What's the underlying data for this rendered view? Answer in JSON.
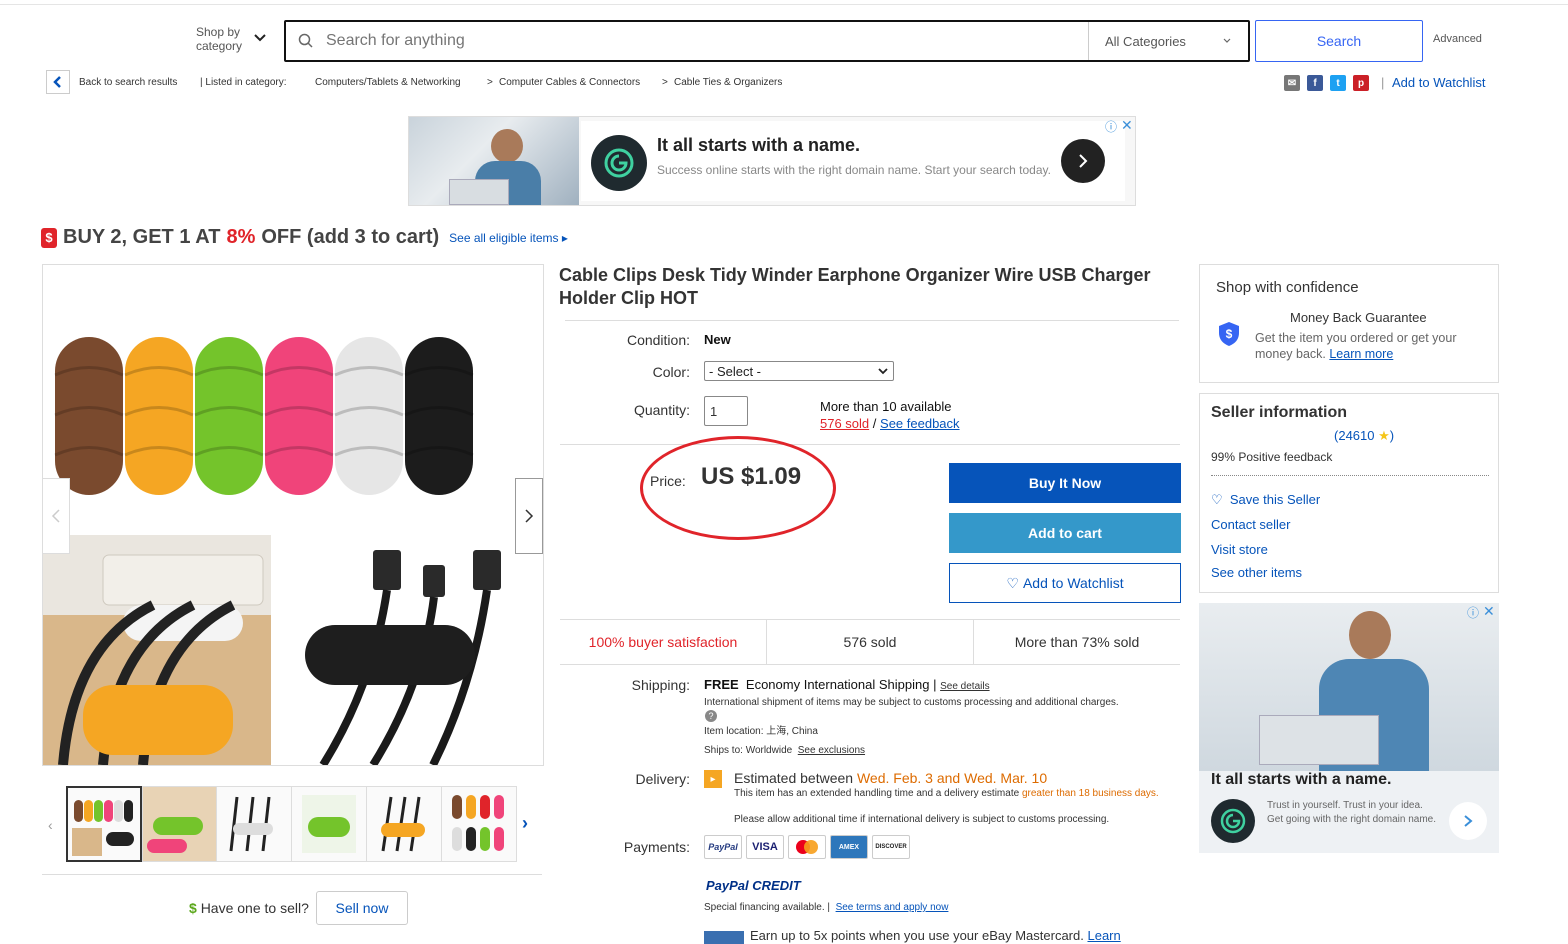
{
  "header": {
    "shop_by": "Shop by",
    "shop_by_2": "category",
    "search_placeholder": "Search for anything",
    "category": "All Categories",
    "search_label": "Search",
    "advanced": "Advanced"
  },
  "breadcrumb": {
    "back": "Back to search results",
    "listed": "| Listed in category:",
    "items": [
      "Computers/Tablets & Networking",
      "Computer Cables & Connectors",
      "Cable Ties & Organizers"
    ],
    "sep": ">",
    "add_to_watchlist": "Add to Watchlist"
  },
  "ad_top": {
    "headline": "It all starts with a name.",
    "body": "Success online starts with the right domain name. Start your search today."
  },
  "promo": {
    "text1": "BUY 2, GET 1 AT",
    "pct": "8%",
    "text2": "OFF (add 3 to cart)",
    "link": "See all eligible items"
  },
  "product": {
    "title": "Cable Clips Desk Tidy Winder Earphone Organizer Wire USB Charger Holder Clip HOT",
    "condition_label": "Condition:",
    "condition": "New",
    "color_label": "Color:",
    "color_value": "- Select -",
    "quantity_label": "Quantity:",
    "quantity": "1",
    "available": "More than 10 available",
    "sold_link": "576 sold",
    "slash": "/",
    "feedback_link": "See feedback",
    "price_label": "Price:",
    "price": "US $1.09",
    "buy_now": "Buy It Now",
    "add_to_cart": "Add to cart",
    "add_to_watchlist": "Add to Watchlist",
    "stats": [
      "100% buyer satisfaction",
      "576 sold",
      "More than 73% sold"
    ],
    "shipping_label": "Shipping:",
    "shipping_free": "FREE",
    "shipping_method": "Economy International Shipping |",
    "see_details": "See details",
    "shipping_note": "International shipment of items may be subject to customs processing and additional charges.",
    "item_location": "Item location: 上海, China",
    "ships_to": "Ships to: Worldwide",
    "see_exclusions": "See exclusions",
    "delivery_label": "Delivery:",
    "delivery_est": "Estimated between",
    "delivery_dates": "Wed. Feb. 3 and Wed. Mar. 10",
    "delivery_note1": "This item has an extended handling time and a delivery estimate",
    "delivery_note1_hl": "greater than 18 business days.",
    "delivery_note2": "Please allow additional time if international delivery is subject to customs processing.",
    "payments_label": "Payments:",
    "payments": [
      "PayPal",
      "VISA",
      "MC",
      "AMEX",
      "DISCOVER"
    ],
    "paypal_credit": "PayPal CREDIT",
    "financing": "Special financing available. |",
    "terms_link": "See terms and apply now",
    "earn": "Earn up to 5x points when you use your eBay Mastercard.",
    "learn": "Learn"
  },
  "gallery": {
    "have_one": "Have one to sell?",
    "sell_now": "Sell now"
  },
  "confidence": {
    "title": "Shop with confidence",
    "mbg": "Money Back Guarantee",
    "mbg_text": "Get the item you ordered or get your money back.",
    "learn_more": "Learn more"
  },
  "seller": {
    "title": "Seller information",
    "score": "24610",
    "feedback": "99% Positive feedback",
    "save": "Save this Seller",
    "contact": "Contact seller",
    "visit": "Visit store",
    "other": "See other items"
  },
  "ad_side": {
    "headline": "It all starts with a name.",
    "body": "Trust in yourself. Trust in your idea. Get going with the right domain name."
  },
  "colors": {
    "accent": "#0654ba",
    "cart": "#3498ca",
    "red": "#e0242a"
  }
}
